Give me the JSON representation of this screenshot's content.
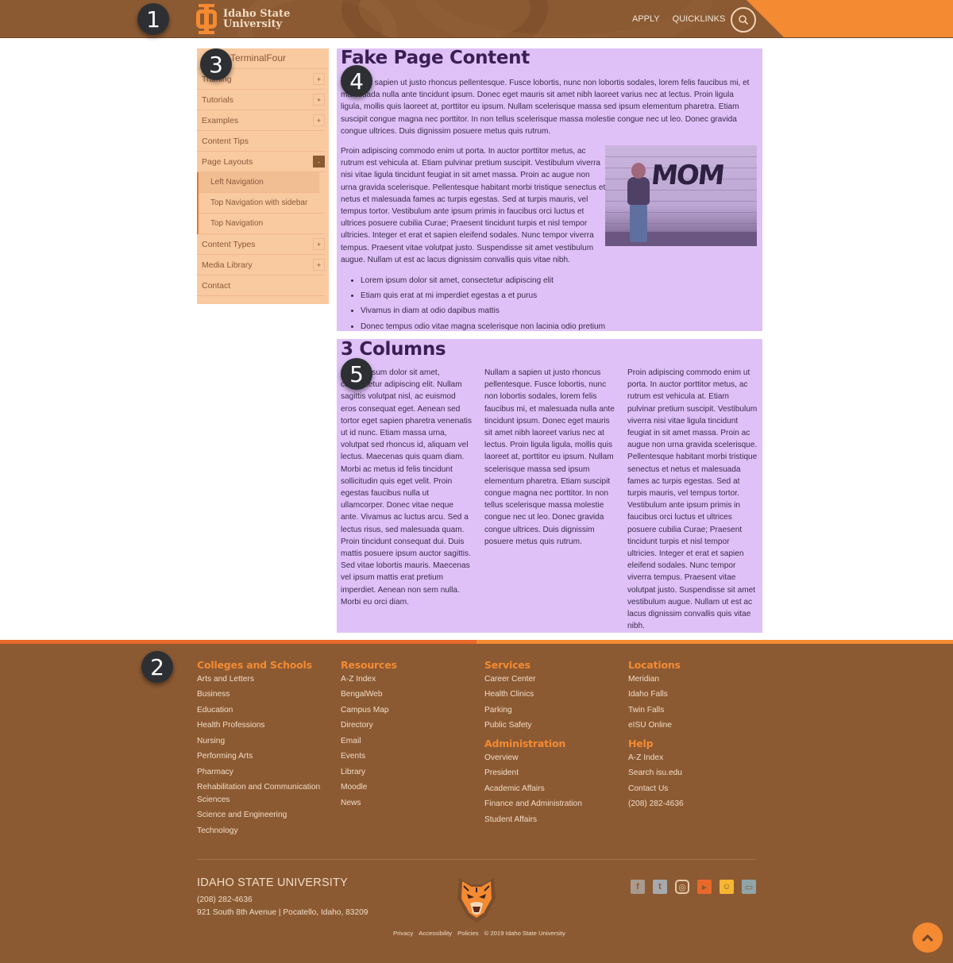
{
  "header": {
    "logo_line1": "Idaho State",
    "logo_line2": "University",
    "nav": [
      "APPLY",
      "QUICKLINKS"
    ],
    "search_icon": "search-icon",
    "colors": {
      "brown": "#8b5a33",
      "orange": "#f48a31"
    }
  },
  "markers": [
    "1",
    "2",
    "3",
    "4",
    "5"
  ],
  "sidebar": {
    "title": "TerminalFour",
    "items": [
      {
        "label": "Training",
        "toggle": "+"
      },
      {
        "label": "Tutorials",
        "toggle": "+"
      },
      {
        "label": "Examples",
        "toggle": "+"
      },
      {
        "label": "Content Tips",
        "toggle": ""
      },
      {
        "label": "Page Layouts",
        "toggle": "-"
      }
    ],
    "subitems": [
      {
        "label": "Left Navigation",
        "active": true
      },
      {
        "label": "Top Navigation with sidebar",
        "active": false
      },
      {
        "label": "Top Navigation",
        "active": false
      }
    ],
    "items_after": [
      {
        "label": "Content Types",
        "toggle": "+"
      },
      {
        "label": "Media Library",
        "toggle": "+"
      },
      {
        "label": "Contact",
        "toggle": ""
      }
    ]
  },
  "main": {
    "heading": "Fake Page Content",
    "para1": "Nullam a sapien ut justo rhoncus pellentesque. Fusce lobortis, nunc non lobortis sodales, lorem felis faucibus mi, et malesuada nulla ante tincidunt ipsum. Donec eget mauris sit amet nibh laoreet varius nec at lectus. Proin ligula ligula, mollis quis laoreet at, porttitor eu ipsum. Nullam scelerisque massa sed ipsum elementum pharetra. Etiam suscipit congue magna nec porttitor. In non tellus scelerisque massa molestie congue nec ut leo. Donec gravida congue ultrices. Duis dignissim posuere metus quis rutrum.",
    "para2": "Proin adipiscing commodo enim ut porta. In auctor porttitor metus, ac rutrum est vehicula at. Etiam pulvinar pretium suscipit. Vestibulum viverra nisi vitae ligula tincidunt feugiat in sit amet massa. Proin ac augue non urna gravida scelerisque. Pellentesque habitant morbi tristique senectus et netus et malesuada fames ac turpis egestas. Sed at turpis mauris, vel tempus tortor. Vestibulum ante ipsum primis in faucibus orci luctus et ultrices posuere cubilia Curae; Praesent tincidunt turpis et nisl tempor ultricies. Integer et erat et sapien eleifend sodales. Nunc tempor viverra tempus. Praesent vitae volutpat justo. Suspendisse sit amet vestibulum augue. Nullam ut est ac lacus dignissim convallis quis vitae nibh.",
    "image_word": "MOM",
    "bullets": [
      "Lorem ipsum dolor sit amet, consectetur adipiscing elit",
      "Etiam quis erat at mi imperdiet egestas a et purus",
      "Vivamus in diam at odio dapibus mattis",
      "Donec tempus odio vitae magna scelerisque non lacinia odio pretium"
    ],
    "columns_heading": "3 Columns",
    "columns": [
      "Lorem ipsum dolor sit amet, consectetur adipiscing elit. Nullam sagittis volutpat nisl, ac euismod eros consequat eget. Aenean sed tortor eget sapien pharetra venenatis ut id nunc. Etiam massa urna, volutpat sed rhoncus id, aliquam vel lectus. Maecenas quis quam diam. Morbi ac metus id felis tincidunt sollicitudin quis eget velit. Proin egestas faucibus nulla ut ullamcorper. Donec vitae neque ante. Vivamus ac luctus arcu. Sed a lectus risus, sed malesuada quam. Proin tincidunt consequat dui. Duis mattis posuere ipsum auctor sagittis. Sed vitae lobortis mauris. Maecenas vel ipsum mattis erat pretium imperdiet. Aenean non sem nulla. Morbi eu orci diam.",
      "Nullam a sapien ut justo rhoncus pellentesque. Fusce lobortis, nunc non lobortis sodales, lorem felis faucibus mi, et malesuada nulla ante tincidunt ipsum. Donec eget mauris sit amet nibh laoreet varius nec at lectus. Proin ligula ligula, mollis quis laoreet at, porttitor eu ipsum. Nullam scelerisque massa sed ipsum elementum pharetra. Etiam suscipit congue magna nec porttitor. In non tellus scelerisque massa molestie congue nec ut leo. Donec gravida congue ultrices. Duis dignissim posuere metus quis rutrum.",
      "Proin adipiscing commodo enim ut porta. In auctor porttitor metus, ac rutrum est vehicula at. Etiam pulvinar pretium suscipit. Vestibulum viverra nisi vitae ligula tincidunt feugiat in sit amet massa. Proin ac augue non urna gravida scelerisque. Pellentesque habitant morbi tristique senectus et netus et malesuada fames ac turpis egestas. Sed at turpis mauris, vel tempus tortor. Vestibulum ante ipsum primis in faucibus orci luctus et ultrices posuere cubilia Curae; Praesent tincidunt turpis et nisl tempor ultricies. Integer et erat et sapien eleifend sodales. Nunc tempor viverra tempus. Praesent vitae volutpat justo. Suspendisse sit amet vestibulum augue. Nullam ut est ac lacus dignissim convallis quis vitae nibh."
    ]
  },
  "footer": {
    "colleges": {
      "heading": "Colleges and Schools",
      "links": [
        "Arts and Letters",
        "Business",
        "Education",
        "Health Professions",
        "Nursing",
        "Performing Arts",
        "Pharmacy",
        "Rehabilitation and Communication Sciences",
        "Science and Engineering",
        "Technology"
      ]
    },
    "resources": {
      "heading": "Resources",
      "links": [
        "A-Z Index",
        "BengalWeb",
        "Campus Map",
        "Directory",
        "Email",
        "Events",
        "Library",
        "Moodle",
        "News"
      ]
    },
    "services": {
      "heading": "Services",
      "links": [
        "Career Center",
        "Health Clinics",
        "Parking",
        "Public Safety"
      ]
    },
    "administration": {
      "heading": "Administration",
      "links": [
        "Overview",
        "President",
        "Academic Affairs",
        "Finance and Administration",
        "Student Affairs"
      ]
    },
    "locations": {
      "heading": "Locations",
      "links": [
        "Meridian",
        "Idaho Falls",
        "Twin Falls",
        "eISU Online"
      ]
    },
    "help": {
      "heading": "Help",
      "links": [
        "A-Z Index",
        "Search isu.edu",
        "Contact Us",
        "(208) 282-4636"
      ]
    },
    "university_name": "IDAHO STATE UNIVERSITY",
    "phone": "(208) 282-4636",
    "address": "921 South 8th Avenue | Pocatello, Idaho, 83209",
    "legal": [
      "Privacy",
      "Accessibility",
      "Policies",
      "© 2019 Idaho State University"
    ],
    "social": [
      {
        "name": "facebook-icon",
        "glyph": "f",
        "color": "#a99a90"
      },
      {
        "name": "twitter-icon",
        "glyph": "t",
        "color": "#a7a9ad"
      },
      {
        "name": "instagram-icon",
        "glyph": "◎",
        "color": "#e9c9a8"
      },
      {
        "name": "youtube-icon",
        "glyph": "▶",
        "color": "#e8692a"
      },
      {
        "name": "snapchat-icon",
        "glyph": "☺",
        "color": "#f7b733"
      },
      {
        "name": "chat-icon",
        "glyph": "▭",
        "color": "#8fa5a8"
      }
    ]
  },
  "back_to_top_icon": "chevron-up-icon"
}
